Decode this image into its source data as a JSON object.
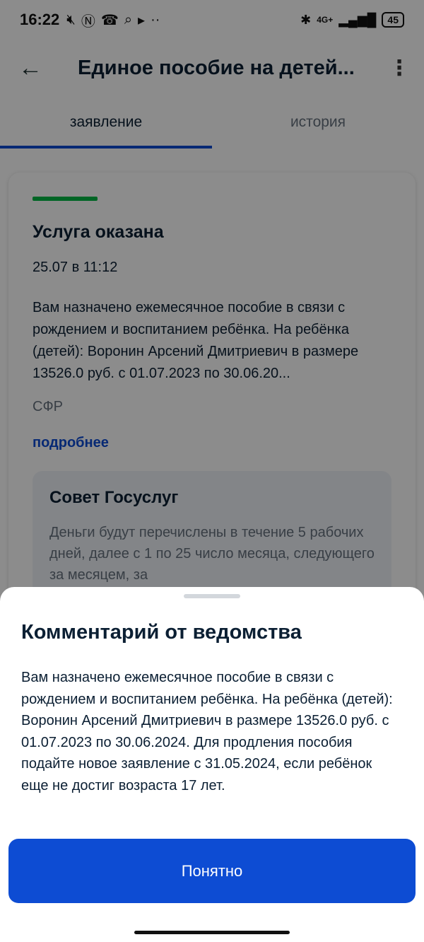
{
  "status_bar": {
    "time": "16:22",
    "left_icons": [
      "mute-icon",
      "nfc-icon",
      "viber-icon",
      "search-icon",
      "play-icon",
      "more-dots-icon"
    ],
    "network": "4G+",
    "battery": "45"
  },
  "appbar": {
    "title": "Единое пособие на детей..."
  },
  "tabs": [
    {
      "label": "заявление",
      "active": true
    },
    {
      "label": "история",
      "active": false
    }
  ],
  "card": {
    "title": "Услуга оказана",
    "date": "25.07 в 11:12",
    "text": "Вам назначено ежемесячное пособие в связи с рождением и воспитанием ребёнка. На ребёнка (детей): Воронин Арсений Дмитриевич в размере 13526.0 руб. с 01.07.2023 по 30.06.20...",
    "org": "СФР",
    "more_link": "подробнее",
    "tip": {
      "title": "Совет Госуслуг",
      "text": "Деньги будут перечислены в течение 5 рабочих дней, далее с 1 по 25 число месяца, следующего за месяцем, за"
    }
  },
  "sheet": {
    "title": "Комментарий от ведомства",
    "text": "Вам назначено ежемесячное пособие в связи с рождением и воспитанием ребёнка. На ребёнка (детей): Воронин Арсений Дмитриевич в размере 13526.0 руб. с 01.07.2023 по 30.06.2024. Для продления пособия подайте новое заявление с 31.05.2024, если ребёнок еще не достиг возраста 17 лет.",
    "button": "Понятно"
  },
  "colors": {
    "primary": "#0d4cd3",
    "success": "#00b944"
  }
}
